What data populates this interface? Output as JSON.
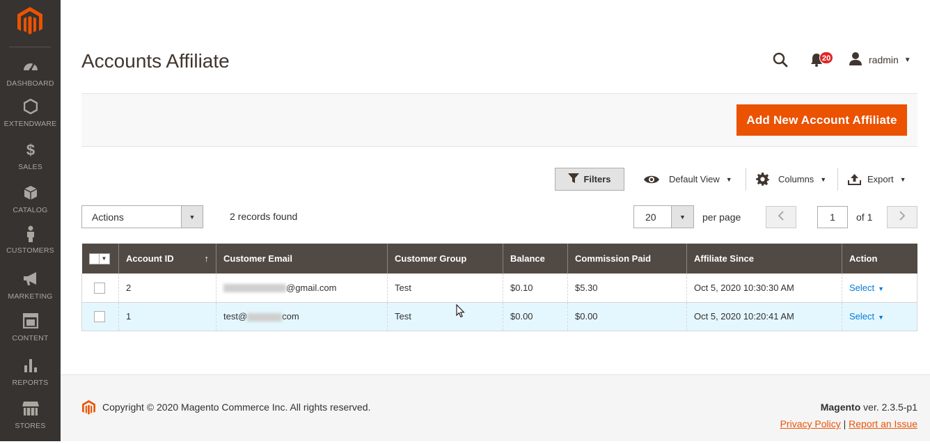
{
  "sidebar": {
    "items": [
      {
        "label": "DASHBOARD",
        "icon": "dashboard-icon"
      },
      {
        "label": "EXTENDWARE",
        "icon": "hexagon-icon"
      },
      {
        "label": "SALES",
        "icon": "dollar-icon"
      },
      {
        "label": "CATALOG",
        "icon": "box-icon"
      },
      {
        "label": "CUSTOMERS",
        "icon": "person-icon"
      },
      {
        "label": "MARKETING",
        "icon": "megaphone-icon"
      },
      {
        "label": "CONTENT",
        "icon": "layout-icon"
      },
      {
        "label": "REPORTS",
        "icon": "bar-chart-icon"
      },
      {
        "label": "STORES",
        "icon": "store-icon"
      }
    ]
  },
  "header": {
    "title": "Accounts Affiliate",
    "notifications_count": "20",
    "user_name": "radmin"
  },
  "page_actions": {
    "add_button": "Add New Account Affiliate"
  },
  "toolbar": {
    "filters": "Filters",
    "view": "Default View",
    "columns": "Columns",
    "export": "Export",
    "actions_select": "Actions",
    "records_found": "2 records found",
    "per_page_value": "20",
    "per_page_label": "per page",
    "page_value": "1",
    "page_of": "of 1"
  },
  "grid": {
    "columns": [
      "Account ID",
      "Customer Email",
      "Customer Group",
      "Balance",
      "Commission Paid",
      "Affiliate Since",
      "Action"
    ],
    "rows": [
      {
        "id": "2",
        "email_suffix": "@gmail.com",
        "email_prefix": "",
        "group": "Test",
        "balance": "$0.10",
        "commission": "$5.30",
        "since": "Oct 5, 2020 10:30:30 AM",
        "action": "Select"
      },
      {
        "id": "1",
        "email_prefix": "test@",
        "email_suffix": "com",
        "group": "Test",
        "balance": "$0.00",
        "commission": "$0.00",
        "since": "Oct 5, 2020 10:20:41 AM",
        "action": "Select"
      }
    ]
  },
  "footer": {
    "copyright": "Copyright © 2020 Magento Commerce Inc. All rights reserved.",
    "brand": "Magento",
    "version": "ver. 2.3.5-p1",
    "privacy": "Privacy Policy",
    "separator": "|",
    "report": "Report an Issue"
  },
  "colors": {
    "accent": "#eb5202",
    "sidebar_bg": "#373330",
    "grid_header_bg": "#514943",
    "link": "#007bdb"
  }
}
